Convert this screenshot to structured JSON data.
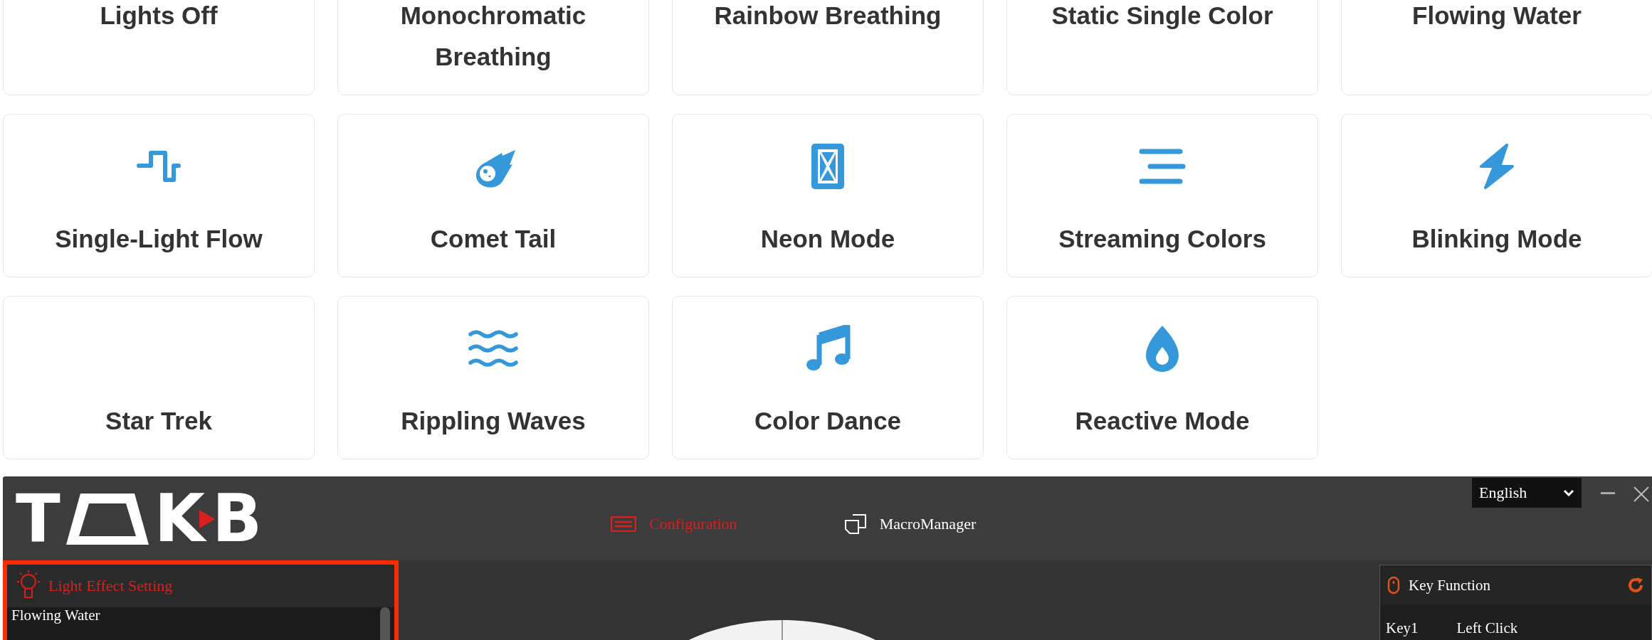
{
  "effects": [
    {
      "label": "Lights Off"
    },
    {
      "label": "Monochromatic Breathing"
    },
    {
      "label": "Rainbow Breathing"
    },
    {
      "label": "Static Single Color"
    },
    {
      "label": "Flowing Water"
    },
    {
      "label": "Single-Light Flow"
    },
    {
      "label": "Comet Tail"
    },
    {
      "label": "Neon Mode"
    },
    {
      "label": "Streaming Colors"
    },
    {
      "label": "Blinking Mode"
    },
    {
      "label": "Star Trek"
    },
    {
      "label": "Rippling Waves"
    },
    {
      "label": "Color Dance"
    },
    {
      "label": "Reactive Mode"
    }
  ],
  "software": {
    "logo": [
      "T",
      "K",
      "B"
    ],
    "tabs": [
      {
        "label": "Configuration",
        "selected": true
      },
      {
        "label": "MacroManager",
        "selected": false
      }
    ],
    "language": "English",
    "light_panel": {
      "title": "Light Effect Setting",
      "items": [
        "Flowing Water"
      ]
    },
    "key_panel": {
      "title": "Key Function",
      "rows": [
        {
          "key": "Key1",
          "function": "Left Click"
        }
      ]
    }
  }
}
